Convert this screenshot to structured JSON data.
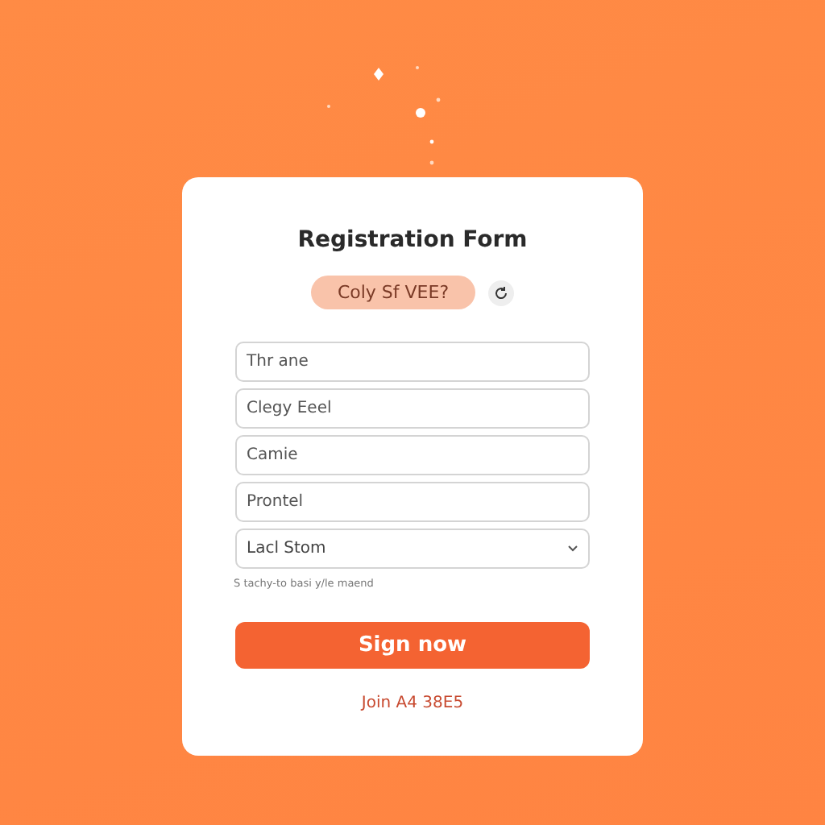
{
  "form": {
    "title": "Registration Form",
    "captcha": "Coly Sf VEE?",
    "fields": [
      {
        "kind": "text",
        "placeholder": "Thr ane"
      },
      {
        "kind": "text",
        "placeholder": "Clegy Eeel"
      },
      {
        "kind": "text",
        "placeholder": "Camie"
      },
      {
        "kind": "text",
        "placeholder": "Prontel"
      },
      {
        "kind": "select",
        "value": "Lacl Stom"
      }
    ],
    "hint": "S tachy-to basi y/le maend",
    "submit": "Sign now",
    "footer_link": "Join A4 38E5"
  }
}
